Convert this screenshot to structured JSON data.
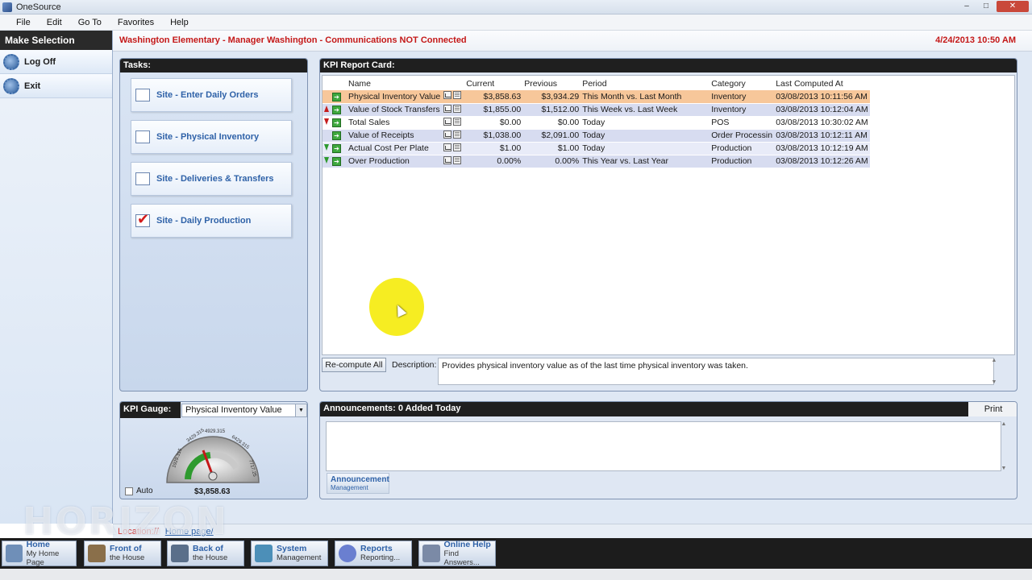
{
  "window": {
    "title": "OneSource",
    "min": "–",
    "max": "□",
    "close": "✕"
  },
  "menu": {
    "items": [
      "File",
      "Edit",
      "Go To",
      "Favorites",
      "Help"
    ]
  },
  "sidebar": {
    "title": "Make Selection",
    "items": [
      {
        "label": "Log Off",
        "icon": "gear-icon"
      },
      {
        "label": "Exit",
        "icon": "gear-icon"
      }
    ]
  },
  "status": {
    "message": "Washington Elementary - Manager Washington - Communications NOT Connected",
    "datetime": "4/24/2013 10:50 AM"
  },
  "tasks": {
    "title": "Tasks:",
    "items": [
      {
        "label": "Site - Enter Daily Orders",
        "checked": false
      },
      {
        "label": "Site - Physical Inventory",
        "checked": false
      },
      {
        "label": "Site - Deliveries & Transfers",
        "checked": false
      },
      {
        "label": "Site - Daily Production",
        "checked": true
      }
    ]
  },
  "kpi_gauge": {
    "title": "KPI Gauge:",
    "selected": "Physical Inventory Value",
    "auto_label": "Auto",
    "value": "$3,858.63",
    "ticks": [
      "1929.315",
      "3429.315",
      "4929.315",
      "6429.315",
      "7717.25"
    ]
  },
  "kpi_report": {
    "title": "KPI Report Card:",
    "columns": [
      "Name",
      "Current",
      "Previous",
      "Period",
      "Category",
      "Last Computed At"
    ],
    "rows": [
      {
        "trend": "none",
        "name": "Physical Inventory Value",
        "current": "$3,858.63",
        "previous": "$3,934.29",
        "period": "This Month vs. Last Month",
        "category": "Inventory",
        "computed": "03/08/2013 10:11:56 AM",
        "style": "sel"
      },
      {
        "trend": "up-red",
        "name": "Value of Stock Transfers",
        "current": "$1,855.00",
        "previous": "$1,512.00",
        "period": "This Week vs. Last Week",
        "category": "Inventory",
        "computed": "03/08/2013 10:12:04 AM",
        "style": "row"
      },
      {
        "trend": "down-red",
        "name": "Total Sales",
        "current": "$0.00",
        "previous": "$0.00",
        "period": "Today",
        "category": "POS",
        "computed": "03/08/2013 10:30:02 AM",
        "style": "plain"
      },
      {
        "trend": "none",
        "name": "Value of Receipts",
        "current": "$1,038.00",
        "previous": "$2,091.00",
        "period": "Today",
        "category": "Order Processin",
        "computed": "03/08/2013 10:12:11 AM",
        "style": "row"
      },
      {
        "trend": "down-green",
        "name": "Actual Cost Per Plate",
        "current": "$1.00",
        "previous": "$1.00",
        "period": "Today",
        "category": "Production",
        "computed": "03/08/2013 10:12:19 AM",
        "style": "alt"
      },
      {
        "trend": "down-green",
        "name": "Over Production",
        "current": "0.00%",
        "previous": "0.00%",
        "period": "This Year vs. Last Year",
        "category": "Production",
        "computed": "03/08/2013 10:12:26 AM",
        "style": "row"
      }
    ],
    "recompute_label": "Re-compute All",
    "description_label": "Description:",
    "description": "Provides physical inventory value as of the last time physical inventory was taken."
  },
  "announcements": {
    "title": "Announcements: 0 Added Today",
    "print_label": "Print",
    "tab_title": "Announcement",
    "tab_sub": "Management"
  },
  "location": {
    "label": "Location://",
    "page": "Home page/"
  },
  "watermark": "HORIZON",
  "nav": [
    {
      "title": "Home",
      "sub": "My Home Page",
      "color": "#6f8fb8"
    },
    {
      "title": "Front of",
      "sub": "the House",
      "color": "#8a6f4a"
    },
    {
      "title": "Back of",
      "sub": "the House",
      "color": "#5a6f8a"
    },
    {
      "title": "System",
      "sub": "Management",
      "color": "#4c8fb8"
    },
    {
      "title": "Reports",
      "sub": "Reporting...",
      "color": "#6a7fd0"
    },
    {
      "title": "Online Help",
      "sub": "Find Answers...",
      "color": "#7b8aa6"
    }
  ]
}
